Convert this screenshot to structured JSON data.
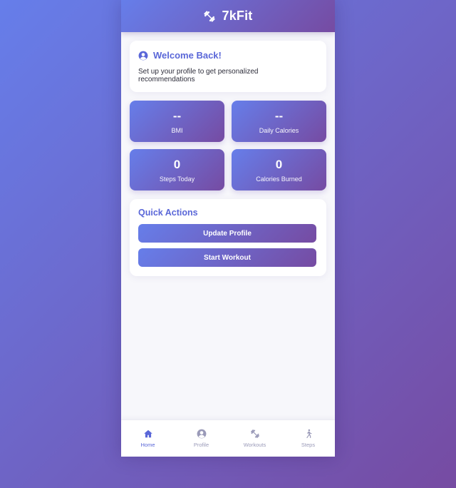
{
  "app": {
    "title": "7kFit",
    "icon": "dumbbell-icon"
  },
  "welcome": {
    "icon": "user-circle-icon",
    "title": "Welcome Back!",
    "text": "Set up your profile to get personalized recommendations"
  },
  "stats": [
    {
      "value": "--",
      "label": "BMI"
    },
    {
      "value": "--",
      "label": "Daily Calories"
    },
    {
      "value": "0",
      "label": "Steps Today"
    },
    {
      "value": "0",
      "label": "Calories Burned"
    }
  ],
  "quick_actions": {
    "title": "Quick Actions",
    "buttons": [
      "Update Profile",
      "Start Workout"
    ]
  },
  "nav": {
    "active": "Home",
    "items": [
      {
        "label": "Home",
        "icon": "home-icon"
      },
      {
        "label": "Profile",
        "icon": "user-circle-icon"
      },
      {
        "label": "Workouts",
        "icon": "dumbbell-icon"
      },
      {
        "label": "Steps",
        "icon": "walking-icon"
      }
    ]
  },
  "colors": {
    "gradient_start": "#667eea",
    "gradient_end": "#764ba2",
    "accent": "#5a67d8",
    "nav_inactive": "#9a9ab8"
  }
}
